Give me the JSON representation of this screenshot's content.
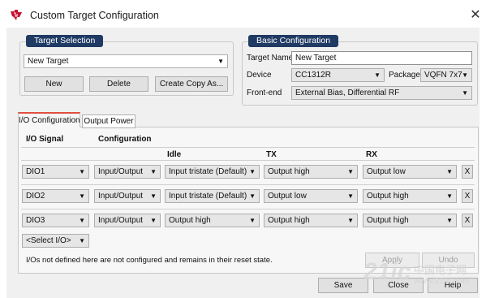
{
  "window": {
    "title": "Custom Target Configuration",
    "close_glyph": "✕"
  },
  "target_selection": {
    "header": "Target Selection",
    "selected": "New Target",
    "buttons": {
      "new": "New",
      "delete": "Delete",
      "create_copy": "Create Copy As..."
    }
  },
  "basic_configuration": {
    "header": "Basic Configuration",
    "target_name_label": "Target Name",
    "target_name_value": "New Target",
    "device_label": "Device",
    "device_value": "CC1312R",
    "package_label": "Package",
    "package_value": "VQFN 7x7",
    "frontend_label": "Front-end",
    "frontend_value": "External Bias, Differential RF"
  },
  "tabs": [
    {
      "label": "I/O Configuration",
      "active": true
    },
    {
      "label": "Output Power",
      "active": false
    }
  ],
  "io": {
    "col_signal": "I/O Signal",
    "col_configuration": "Configuration",
    "sub_idle": "Idle",
    "sub_tx": "TX",
    "sub_rx": "RX",
    "rows": [
      {
        "signal": "DIO1",
        "config": "Input/Output",
        "idle": "Input tristate (Default)",
        "tx": "Output high",
        "rx": "Output low",
        "remove": "X"
      },
      {
        "signal": "DIO2",
        "config": "Input/Output",
        "idle": "Input tristate (Default)",
        "tx": "Output low",
        "rx": "Output high",
        "remove": "X"
      },
      {
        "signal": "DIO3",
        "config": "Input/Output",
        "idle": "Output high",
        "tx": "Output high",
        "rx": "Output high",
        "remove": "X"
      }
    ],
    "select_io": "<Select I/O>",
    "note": "I/Os not defined here are not configured and remains in their reset state.",
    "apply": "Apply",
    "undo": "Undo"
  },
  "footer": {
    "save": "Save",
    "close": "Close",
    "help": "Help"
  },
  "watermark": {
    "main": "21ic",
    "chinese": "中国电子网",
    "site": "www.21ic.com"
  },
  "dropdown_arrow": "▼",
  "colors": {
    "header_bg": "#1f3a63",
    "tab_accent": "#e05040",
    "brand_red": "#c8102e"
  },
  "icons": {
    "app": "ti-logo-icon"
  }
}
